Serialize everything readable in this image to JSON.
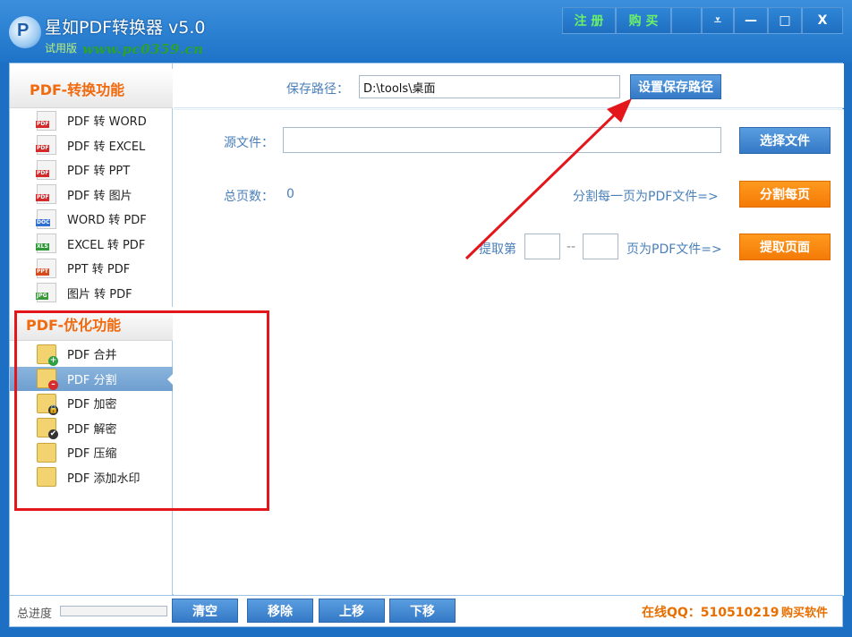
{
  "window": {
    "logo_letter": "P",
    "title": "星如PDF转换器 v5.0",
    "trial_label": "试用版",
    "watermark": "www.pc0359.cn",
    "register_label": "注 册",
    "buy_label": "购 买",
    "menu_glyph": "⩡",
    "minimize_glyph": "—",
    "maximize_glyph": "□",
    "close_glyph": "X"
  },
  "sidebar": {
    "convert_header": "PDF-转换功能",
    "convert_items": [
      {
        "label": "PDF 转 WORD",
        "icon": "pdf-file-icon",
        "tag": "PDF",
        "tag_color": "#d42a2a"
      },
      {
        "label": "PDF 转 EXCEL",
        "icon": "pdf-file-icon",
        "tag": "PDF",
        "tag_color": "#d42a2a"
      },
      {
        "label": "PDF 转 PPT",
        "icon": "pdf-file-icon",
        "tag": "PDF",
        "tag_color": "#d42a2a"
      },
      {
        "label": "PDF 转 图片",
        "icon": "pdf-file-icon",
        "tag": "PDF",
        "tag_color": "#d42a2a"
      },
      {
        "label": "WORD 转 PDF",
        "icon": "doc-file-icon",
        "tag": "DOC",
        "tag_color": "#2f6fd0"
      },
      {
        "label": "EXCEL 转 PDF",
        "icon": "xls-file-icon",
        "tag": "XLS",
        "tag_color": "#2e9a37"
      },
      {
        "label": "PPT 转 PDF",
        "icon": "ppt-file-icon",
        "tag": "PPT",
        "tag_color": "#d84a1b"
      },
      {
        "label": "图片 转 PDF",
        "icon": "jpg-file-icon",
        "tag": "JPG",
        "tag_color": "#3a9a3a"
      }
    ],
    "optimize_header": "PDF-优化功能",
    "optimize_items": [
      {
        "label": "PDF 合并",
        "icon": "folder-add-icon",
        "badge": "+",
        "badge_color": "#2ea043"
      },
      {
        "label": "PDF 分割",
        "icon": "folder-remove-icon",
        "badge": "–",
        "badge_color": "#d62c2c",
        "active": true
      },
      {
        "label": "PDF 加密",
        "icon": "lock-folder-icon",
        "badge": "🔒",
        "badge_color": "#333333"
      },
      {
        "label": "PDF 解密",
        "icon": "check-folder-icon",
        "badge": "✔",
        "badge_color": "#333333"
      },
      {
        "label": "PDF 压缩",
        "icon": "compress-icon",
        "badge": "",
        "badge_color": "#4a7fb8"
      },
      {
        "label": "PDF 添加水印",
        "icon": "watermark-icon",
        "badge": "",
        "badge_color": "#c8a53a"
      }
    ]
  },
  "save": {
    "label": "保存路径：",
    "path_value": "D:\\tools\\桌面",
    "button_label": "设置保存路径"
  },
  "main": {
    "source_label": "源文件：",
    "source_value": "",
    "choose_button": "选择文件",
    "pages_label": "总页数：",
    "pages_value": "0",
    "split_hint": "分割每一页为PDF文件=>",
    "split_button": "分割每页",
    "extract_prefix": "提取第",
    "extract_from": "",
    "extract_sep": "--",
    "extract_to": "",
    "extract_suffix": "页为PDF文件=>",
    "extract_button": "提取页面"
  },
  "bottom": {
    "progress_label": "总进度",
    "progress_value": 0,
    "clear_button": "清空",
    "remove_button": "移除",
    "up_button": "上移",
    "down_button": "下移",
    "qq_text": "在线QQ：510510219",
    "buy_link": "购买软件"
  },
  "colors": {
    "accent_orange": "#f47a06",
    "accent_blue": "#3479c7",
    "annotation_red": "#e3161c"
  }
}
